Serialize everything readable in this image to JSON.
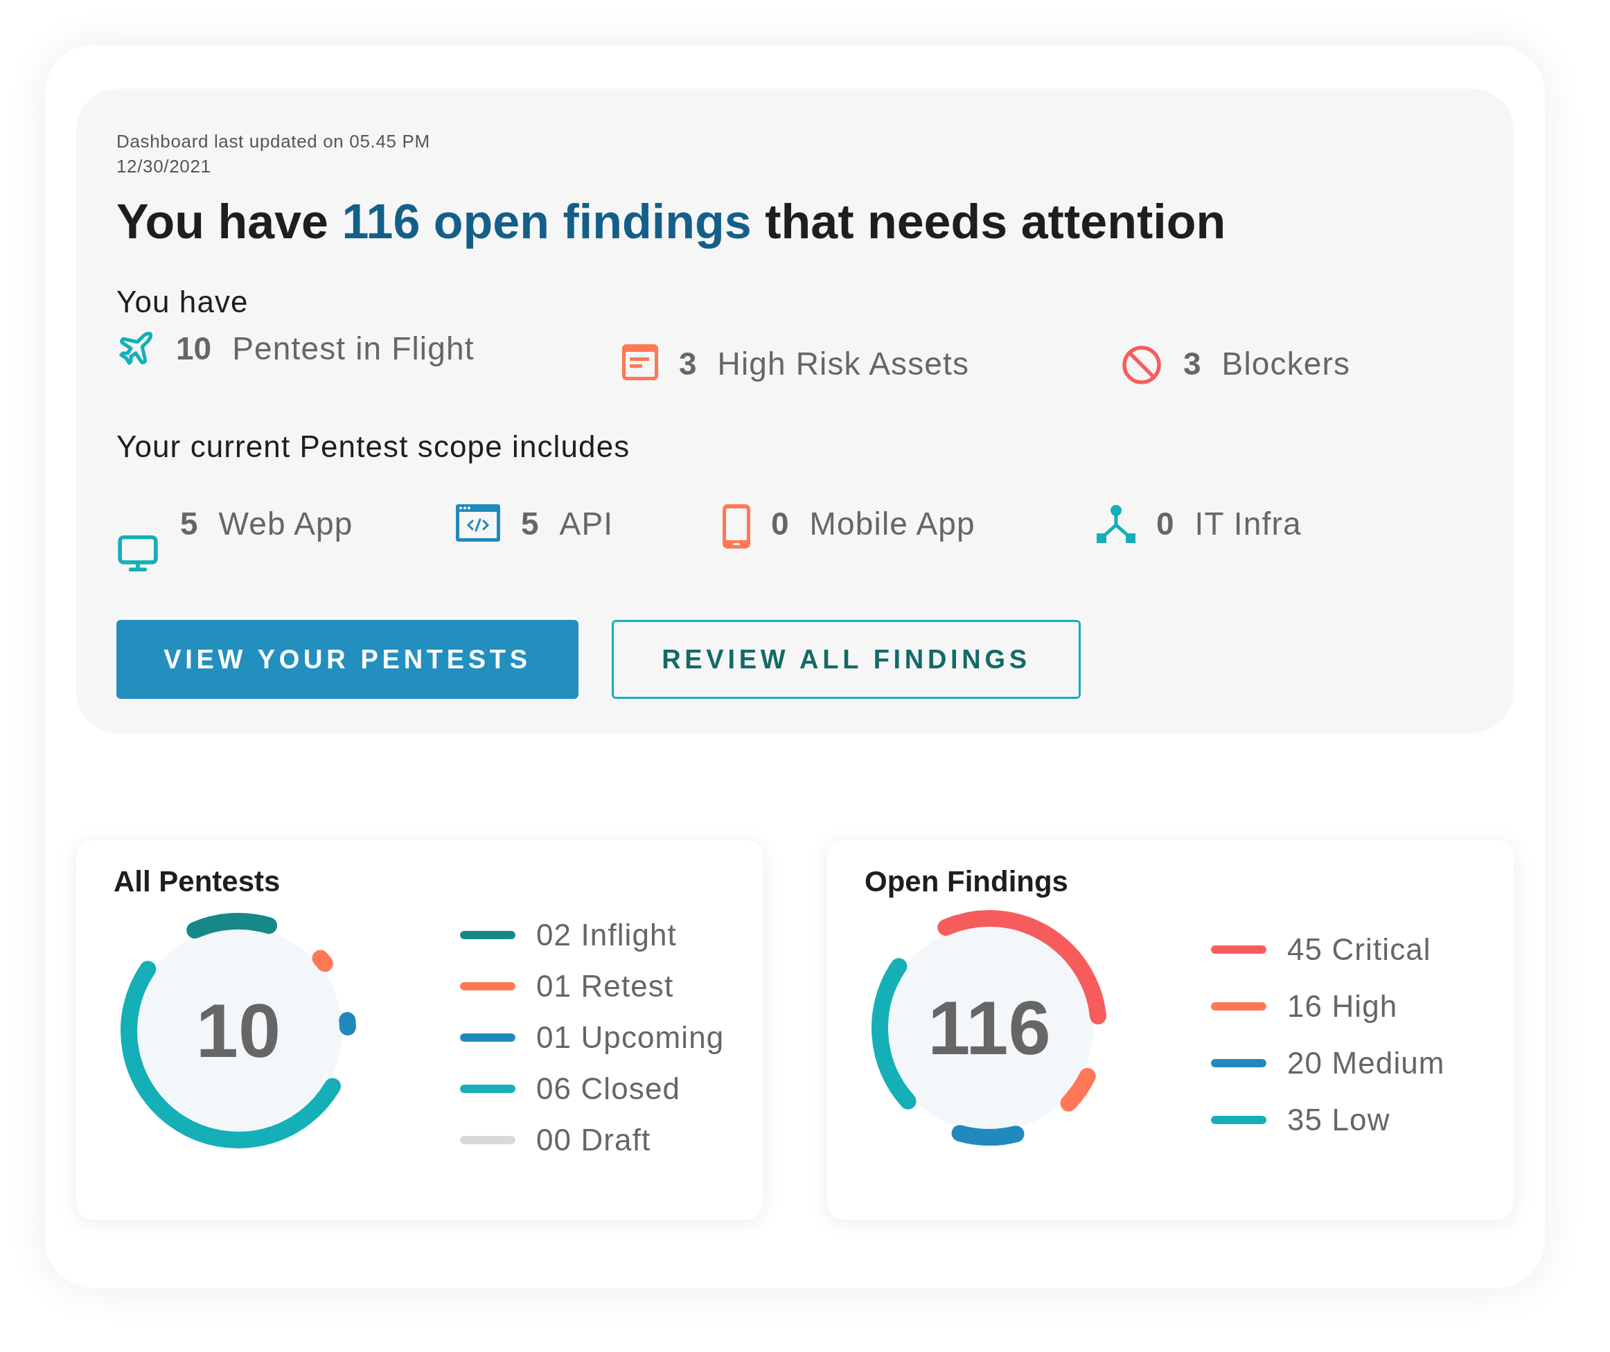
{
  "header": {
    "updated": "Dashboard last updated on 05.45 PM",
    "date": "12/30/2021",
    "headline": {
      "before": "You have",
      "highlight": "116 open findings",
      "after": "that needs attention"
    }
  },
  "summary": {
    "label": "You have",
    "items": [
      {
        "kind": "flight",
        "count": "10",
        "label": "Pentest in Flight"
      },
      {
        "kind": "assets",
        "count": "3",
        "label": "High Risk Assets"
      },
      {
        "kind": "blockers",
        "count": "3",
        "label": "Blockers"
      }
    ]
  },
  "scope": {
    "label": "Your current Pentest scope includes",
    "items": [
      {
        "kind": "web",
        "count": "5",
        "label": "Web App"
      },
      {
        "kind": "api",
        "count": "5",
        "label": "API"
      },
      {
        "kind": "mobile",
        "count": "0",
        "label": "Mobile App"
      },
      {
        "kind": "infra",
        "count": "0",
        "label": "IT Infra"
      }
    ]
  },
  "buttons": [
    {
      "kind": "primary",
      "label": "VIEW YOUR PENTESTS"
    },
    {
      "kind": "outline",
      "label": "REVIEW ALL FINDINGS"
    }
  ],
  "cards": [
    {
      "title": "All Pentests",
      "total": "10",
      "legend": [
        {
          "count": "02",
          "label": "Inflight",
          "color": "#158887"
        },
        {
          "count": "01",
          "label": "Retest",
          "color": "#ff7855"
        },
        {
          "count": "01",
          "label": "Upcoming",
          "color": "#2289bd"
        },
        {
          "count": "06",
          "label": "Closed",
          "color": "#14afb7"
        },
        {
          "count": "00",
          "label": "Draft",
          "color": "#d9d9d9"
        }
      ]
    },
    {
      "title": "Open Findings",
      "total": "116",
      "legend": [
        {
          "count": "45",
          "label": "Critical",
          "color": "#f75c5c"
        },
        {
          "count": "16",
          "label": "High",
          "color": "#ff7855"
        },
        {
          "count": "20",
          "label": "Medium",
          "color": "#2289bd"
        },
        {
          "count": "35",
          "label": "Low",
          "color": "#14afb7"
        }
      ]
    }
  ]
}
